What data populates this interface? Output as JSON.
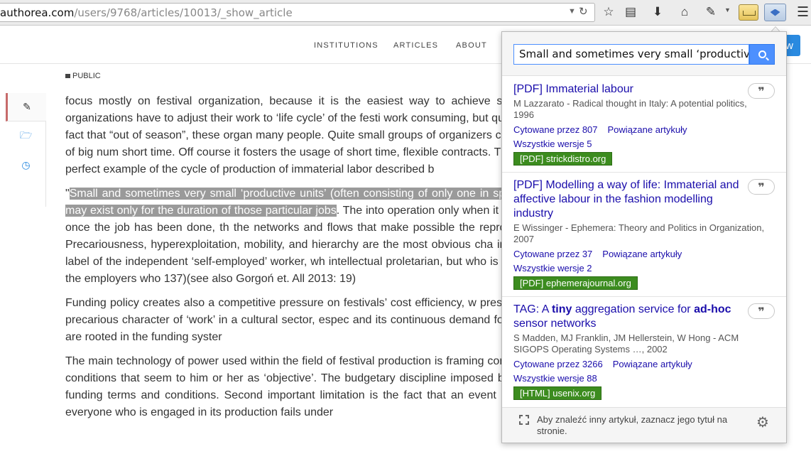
{
  "browser": {
    "url_host": "authorea.com",
    "url_path": "/users/9768/articles/10013/_show_article"
  },
  "site_nav": {
    "items": [
      "INSTITUTIONS",
      "ARTICLES",
      "ABOUT"
    ],
    "button_label": "w"
  },
  "article": {
    "visibility": "PUBLIC",
    "p1": "focus mostly on festival organization, because it is the easiest way to achieve suffic activity. Although this organizations have to adjust their work to ‘life cycle’ of the festi work consuming, but quite short, which triggers the fact that “out of season”, these organ many people. Quite small groups of organizers creates a demand for a work of big num short time. Off course it fosters the usage of short time, flexible contracts. Thus festival p treated as the perfect example of the cycle of production of immaterial labor described b",
    "p2_quote_open": "\"",
    "p2_highlight": "Small and sometimes very small ‘productive units’ (often consisting of only one in specific ad hoc projects, and may exist only for the duration of those particular jobs",
    "p2_rest": ". The into operation only when it is required by the capitalist; once the job has been done, th the networks and flows that make possible the reproduction and enrichment of Precariousness, hyperexploitation, mobility, and hierarchy are the most obvious cha immaterial labor. Behind the label of the independent ‘self-employed’ worker, wh intellectual proletarian, but who is recognized as such only by the employers who 137)(see also Gorgoń et. All 2013: 19)",
    "p3": "Funding policy creates also a competitive pressure on festivals’ cost efficiency, w pressure on price of labor. Both precarious character of ‘work’ in a cultural sector, espec and its continuous demand for a low paid and free labor, are rooted in the funding syster",
    "p4": "The main technology of power used within the field of festival production is framing confronting acting subject with conditions that seem to him or her as ‘objective’. The budgetary discipline imposed by funders, and followed by funding terms and conditions. Second important limitation is the fact that an event cannot be postponed, thus everyone who is engaged in its production fails under"
  },
  "scholar": {
    "query": "Small and sometimes very small ‘productive",
    "results": [
      {
        "title": "[PDF] Immaterial labour",
        "meta": "M Lazzarato - Radical thought in Italy: A potential politics, 1996",
        "cited": "Cytowane przez 807",
        "related": "Powiązane artykuły",
        "versions": "Wszystkie wersje 5",
        "source": "[PDF] strickdistro.org"
      },
      {
        "title": "[PDF] Modelling a way of life: Immaterial and affective labour in the fashion modelling industry",
        "meta": "E Wissinger - Ephemera: Theory and Politics in Organization, 2007",
        "cited": "Cytowane przez 37",
        "related": "Powiązane artykuły",
        "versions": "Wszystkie wersje 2",
        "source": "[PDF] ephemerajournal.org"
      },
      {
        "title_a": "TAG: A ",
        "title_b": "tiny",
        "title_c": " aggregation service for ",
        "title_d": "ad-hoc",
        "title_e": " sensor networks",
        "meta": "S Madden, MJ Franklin, JM Hellerstein, W Hong - ACM SIGOPS Operating Systems …, 2002",
        "cited": "Cytowane przez 3266",
        "related": "Powiązane artykuły",
        "versions": "Wszystkie wersje 88",
        "source": "[HTML] usenix.org"
      }
    ],
    "cite_label": "❞",
    "footer_text": "Aby znaleźć inny artykuł, zaznacz jego tytuł na stronie."
  }
}
